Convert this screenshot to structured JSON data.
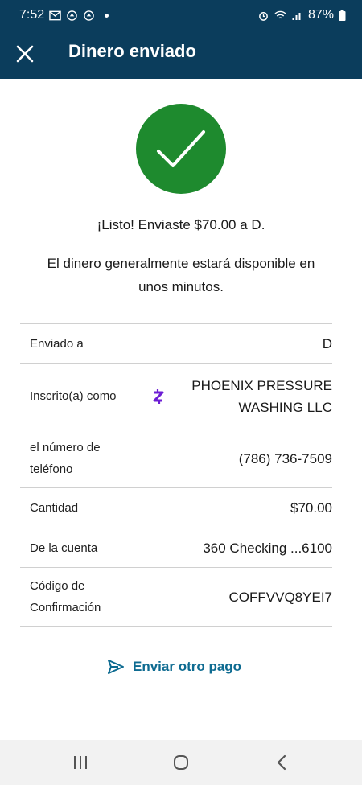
{
  "status_bar": {
    "time": "7:52",
    "battery": "87%",
    "icons": [
      "gmail-icon",
      "app-notification-icon",
      "app-notification-icon",
      "alarm-icon",
      "wifi-icon",
      "signal-icon",
      "battery-icon"
    ]
  },
  "appbar": {
    "title": "Dinero enviado",
    "close_icon": "close-icon"
  },
  "success": {
    "icon": "checkmark-icon",
    "message": "¡Listo! Enviaste $70.00 a D.",
    "availability": "El dinero generalmente estará disponible en unos minutos."
  },
  "details": {
    "sent_to": {
      "label": "Enviado a",
      "value": "D"
    },
    "enrolled_as": {
      "label": "Inscrito(a) como",
      "value": "PHOENIX PRESSURE WASHING LLC",
      "icon": "zelle-icon"
    },
    "phone": {
      "label": "el número de teléfono",
      "value": "(786) 736-7509"
    },
    "amount": {
      "label": "Cantidad",
      "value": "$70.00"
    },
    "account": {
      "label": "De la cuenta",
      "value": "360 Checking ...6100"
    },
    "confirmation": {
      "label": "Código de Confirmación",
      "value": "COFFVVQ8YEI7"
    }
  },
  "actions": {
    "send_again_label": "Enviar otro pago",
    "send_again_icon": "send-icon"
  },
  "nav": {
    "recents_icon": "recents-icon",
    "home_icon": "home-icon",
    "back_icon": "back-icon"
  },
  "colors": {
    "header_bg": "#0b3d5c",
    "success_green": "#1e8a2e",
    "link_blue": "#0e6b91",
    "zelle_purple": "#6d1ed4"
  }
}
